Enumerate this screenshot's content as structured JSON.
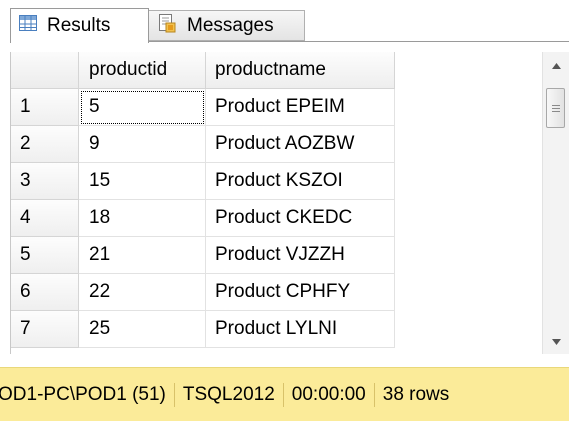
{
  "tabs": {
    "results_label": "Results",
    "messages_label": "Messages"
  },
  "grid": {
    "columns": [
      "",
      "productid",
      "productname"
    ],
    "rows": [
      {
        "num": "1",
        "productid": "5",
        "productname": "Product EPEIM"
      },
      {
        "num": "2",
        "productid": "9",
        "productname": "Product AOZBW"
      },
      {
        "num": "3",
        "productid": "15",
        "productname": "Product KSZOI"
      },
      {
        "num": "4",
        "productid": "18",
        "productname": "Product CKEDC"
      },
      {
        "num": "5",
        "productid": "21",
        "productname": "Product VJZZH"
      },
      {
        "num": "6",
        "productid": "22",
        "productname": "Product CPHFY"
      },
      {
        "num": "7",
        "productid": "25",
        "productname": "Product LYLNI"
      }
    ]
  },
  "status": {
    "server": "OD1-PC\\POD1 (51)",
    "database": "TSQL2012",
    "elapsed": "00:00:00",
    "rows": "38 rows"
  },
  "colors": {
    "status_background": "#fbeb99",
    "grid_line": "#e2e2e2"
  },
  "icons": {
    "results_tab": "grid-icon",
    "messages_tab": "messages-icon"
  }
}
